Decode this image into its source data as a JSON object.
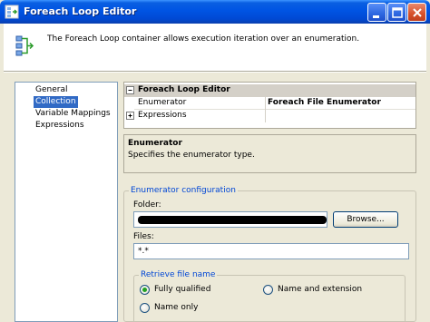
{
  "window": {
    "title": "Foreach Loop Editor",
    "controls": {
      "minimize": "minimize-icon",
      "maximize": "maximize-icon",
      "close": "close-icon"
    }
  },
  "header": {
    "icon": "foreach-loop-icon",
    "description": "The Foreach Loop container allows execution iteration over an enumeration."
  },
  "nav": {
    "selected": 1,
    "items": [
      {
        "label": "General"
      },
      {
        "label": "Collection"
      },
      {
        "label": "Variable Mappings"
      },
      {
        "label": "Expressions"
      }
    ]
  },
  "property_grid": {
    "category": "Foreach Loop Editor",
    "rows": [
      {
        "name": "Enumerator",
        "value": "Foreach File Enumerator"
      },
      {
        "name": "Expressions",
        "value": ""
      }
    ]
  },
  "description_panel": {
    "title": "Enumerator",
    "text": "Specifies the enumerator type."
  },
  "enumerator_config": {
    "title": "Enumerator configuration",
    "folder_label": "Folder:",
    "folder_value_redacted": true,
    "browse_label": "Browse...",
    "files_label": "Files:",
    "files_value": "*.*",
    "retrieve": {
      "title": "Retrieve file name",
      "options": [
        {
          "label": "Fully qualified",
          "checked": true
        },
        {
          "label": "Name and extension",
          "checked": false
        },
        {
          "label": "Name only",
          "checked": false
        }
      ]
    }
  },
  "colors": {
    "title_bar": "#0054e3",
    "selection": "#316ac5",
    "group_title": "#0046d5",
    "dialog_bg": "#ece9d8"
  }
}
